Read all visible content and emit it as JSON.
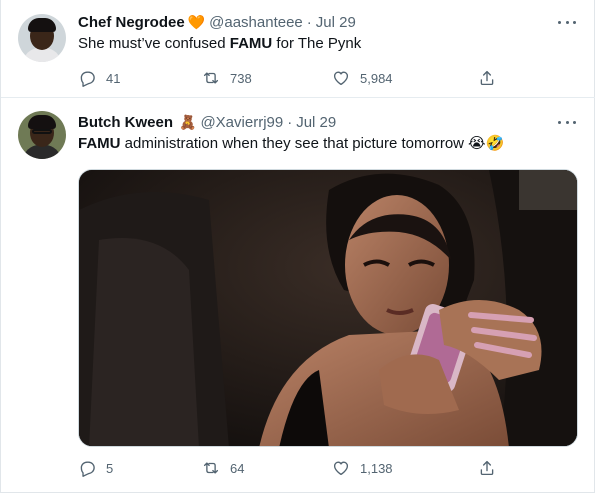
{
  "tweets": [
    {
      "name": "Chef Negrodee",
      "name_emoji": "🧡",
      "handle": "@aashanteee",
      "separator": "·",
      "date": "Jul 29",
      "text_plain_1": "She must’ve confused ",
      "text_bold": "FAMU",
      "text_plain_2": " for The Pynk",
      "text_emoji": "",
      "replies": "41",
      "retweets": "738",
      "likes": "5,984"
    },
    {
      "name": "Butch Kween",
      "name_emoji": "🧸",
      "handle": "@Xavierrj99",
      "separator": "·",
      "date": "Jul 29",
      "text_bold": "FAMU",
      "text_plain_1": " administration when they see that picture tomorrow",
      "text_emoji": "😭🤣",
      "replies": "5",
      "retweets": "64",
      "likes": "1,138"
    }
  ],
  "icons": {
    "reply": "reply-icon",
    "retweet": "retweet-icon",
    "like": "heart-icon",
    "share": "share-icon",
    "more": "more-options-icon"
  },
  "colors": {
    "text_primary": "#0f1419",
    "text_secondary": "#536471",
    "divider": "#e6ecf0"
  }
}
